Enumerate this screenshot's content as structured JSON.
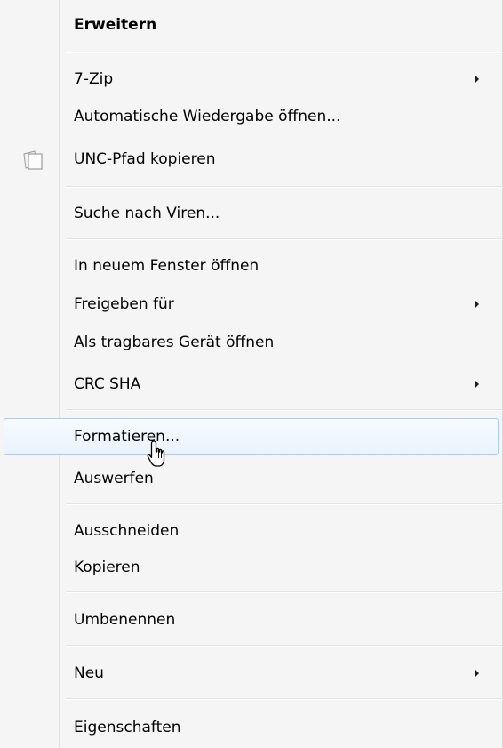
{
  "menu": {
    "items": [
      {
        "label": "Erweitern",
        "bold": true,
        "submenu": false
      },
      {
        "label": "7-Zip",
        "submenu": true
      },
      {
        "label": "Automatische Wiedergabe öffnen...",
        "submenu": false
      },
      {
        "label": "UNC-Pfad kopieren",
        "submenu": false,
        "icon": "copy-pages-icon"
      },
      {
        "label": "Suche nach Viren...",
        "submenu": false
      },
      {
        "label": "In neuem Fenster öffnen",
        "submenu": false
      },
      {
        "label": "Freigeben für",
        "submenu": true
      },
      {
        "label": "Als tragbares Gerät öffnen",
        "submenu": false
      },
      {
        "label": "CRC SHA",
        "submenu": true
      },
      {
        "label": "Formatieren...",
        "submenu": false,
        "highlighted": true
      },
      {
        "label": "Auswerfen",
        "submenu": false
      },
      {
        "label": "Ausschneiden",
        "submenu": false
      },
      {
        "label": "Kopieren",
        "submenu": false
      },
      {
        "label": "Umbenennen",
        "submenu": false
      },
      {
        "label": "Neu",
        "submenu": true
      },
      {
        "label": "Eigenschaften",
        "submenu": false
      }
    ]
  },
  "cursor": {
    "icon": "hand-pointer-icon"
  },
  "colors": {
    "menu_background": "#f5f5f5",
    "highlight_border": "#a9cdf2",
    "highlight_fill": "#eaf3fd",
    "separator": "#e2e3e3",
    "text": "#000000"
  }
}
